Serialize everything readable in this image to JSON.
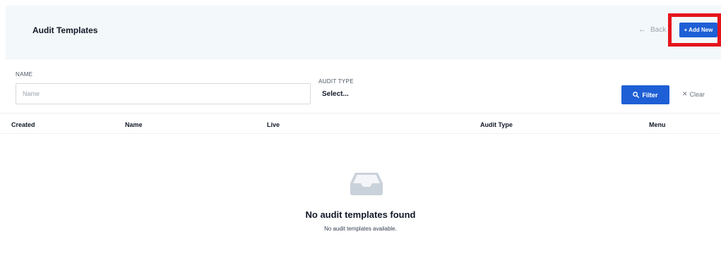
{
  "header": {
    "title": "Audit Templates",
    "back_label": "Back",
    "back_arrow": "←",
    "add_new_label": "+ Add New"
  },
  "filters": {
    "name_label": "NAME",
    "name_placeholder": "Name",
    "audit_type_label": "AUDIT TYPE",
    "audit_type_value": "Select...",
    "filter_label": "Filter",
    "clear_label": "Clear",
    "clear_symbol": "✕"
  },
  "table": {
    "columns": [
      "Created",
      "Name",
      "Live",
      "Audit Type",
      "Menu"
    ]
  },
  "empty_state": {
    "title": "No audit templates found",
    "subtitle": "No audit templates available.",
    "icon": "inbox-icon"
  },
  "colors": {
    "accent": "#1e5fd6",
    "header_bg": "#f3f8fa",
    "highlight": "#e5141c"
  }
}
